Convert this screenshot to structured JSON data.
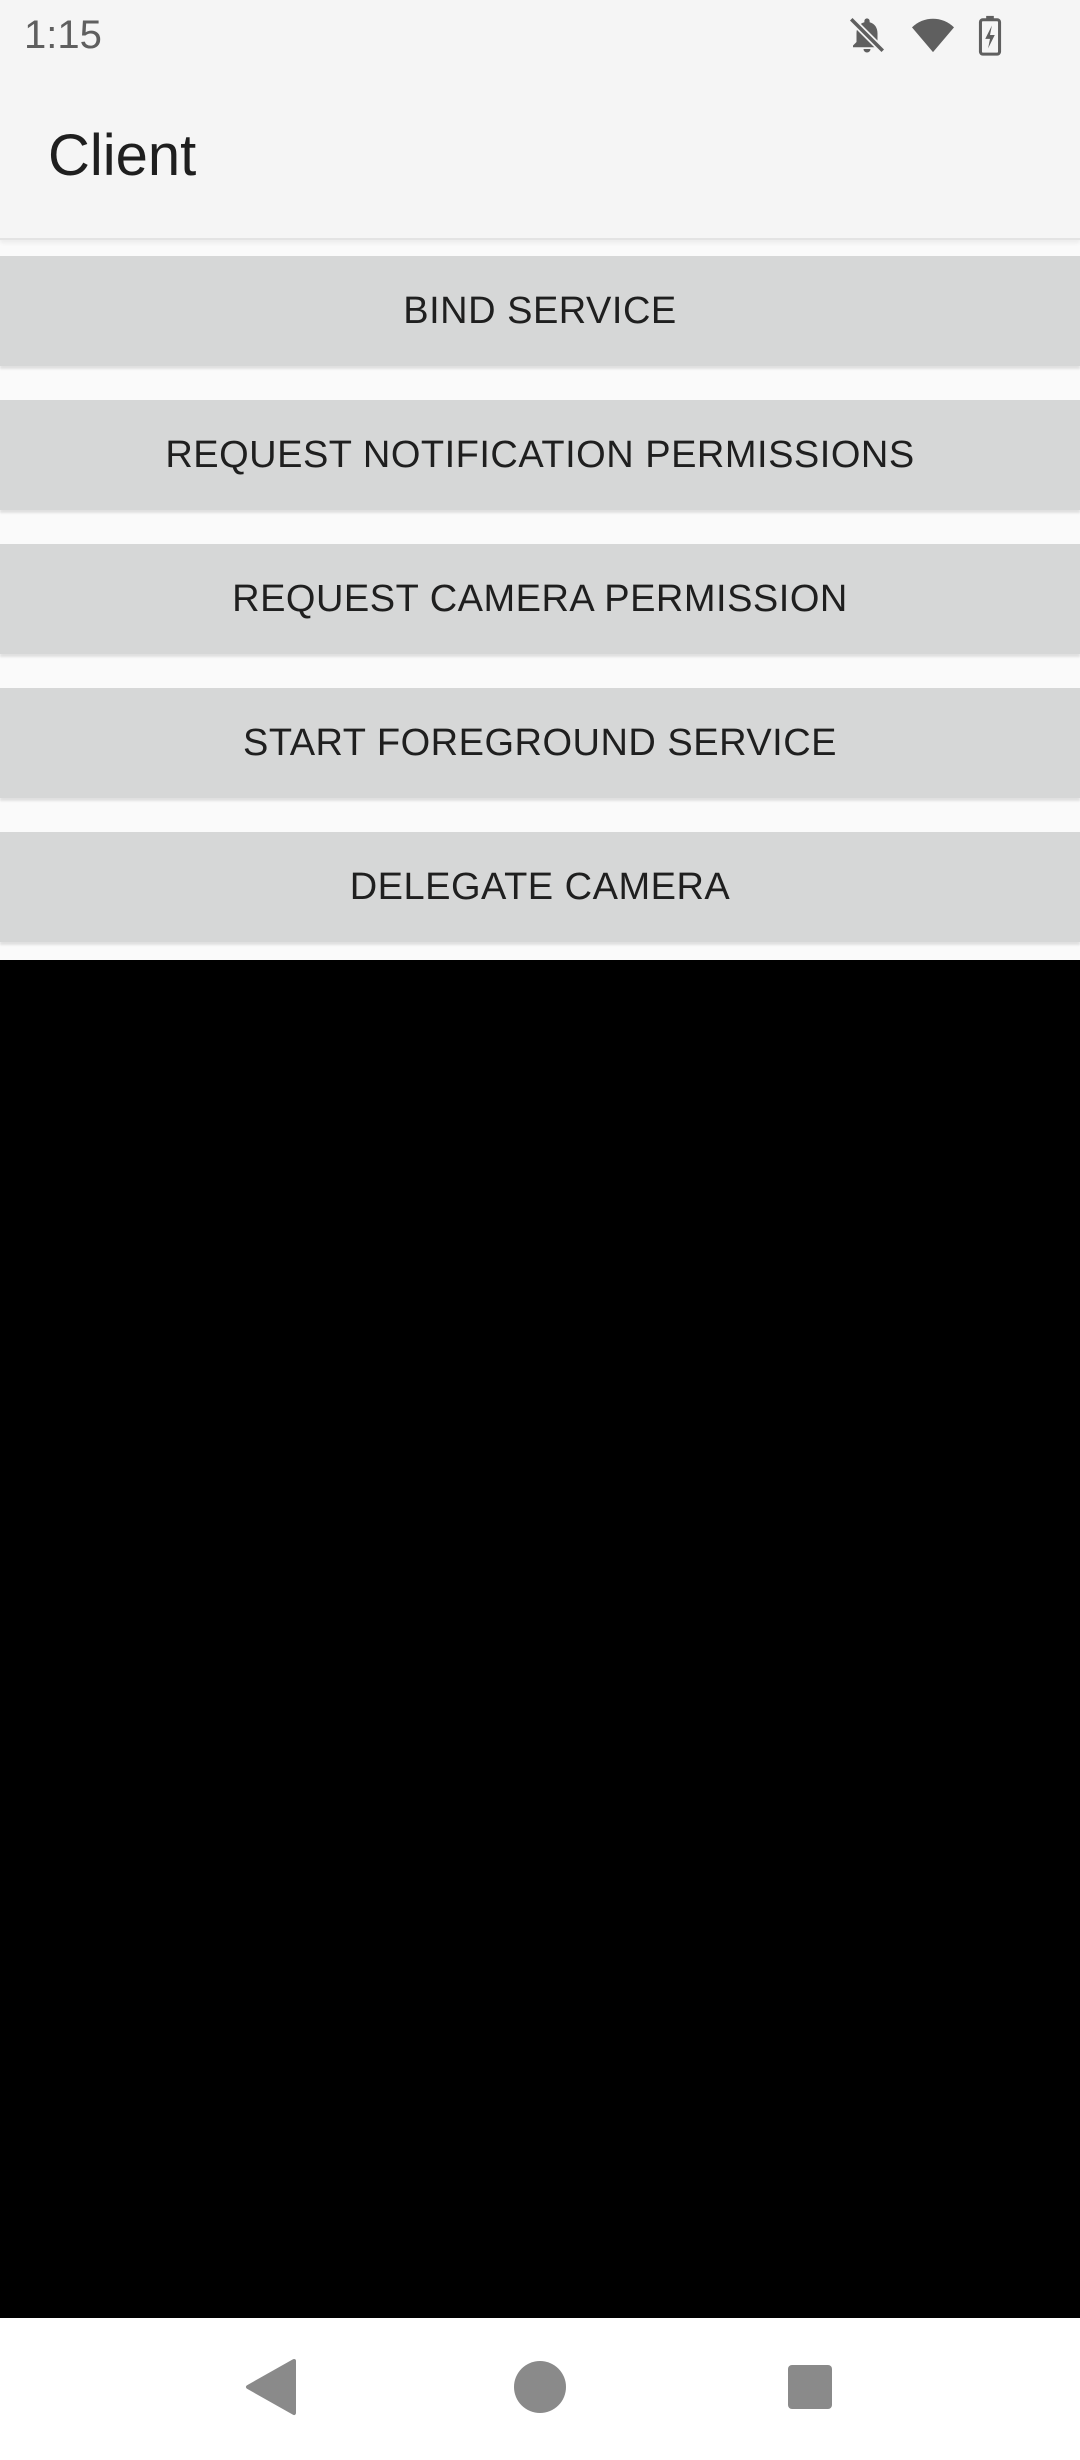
{
  "status_bar": {
    "time": "1:15",
    "icons": [
      "notifications-off-icon",
      "wifi-icon",
      "battery-charging-icon"
    ]
  },
  "app_bar": {
    "title": "Client"
  },
  "buttons": [
    {
      "label": "BIND SERVICE"
    },
    {
      "label": "REQUEST NOTIFICATION PERMISSIONS"
    },
    {
      "label": "REQUEST CAMERA PERMISSION"
    },
    {
      "label": "START FOREGROUND SERVICE"
    },
    {
      "label": "DELEGATE CAMERA"
    }
  ],
  "navigation": {
    "icons": [
      "back-icon",
      "home-icon",
      "recents-icon"
    ]
  },
  "colors": {
    "button_background": "#d6d7d7",
    "app_bar_background": "#f5f5f5",
    "preview_background": "#000000",
    "nav_icon": "#8a8a8a"
  }
}
